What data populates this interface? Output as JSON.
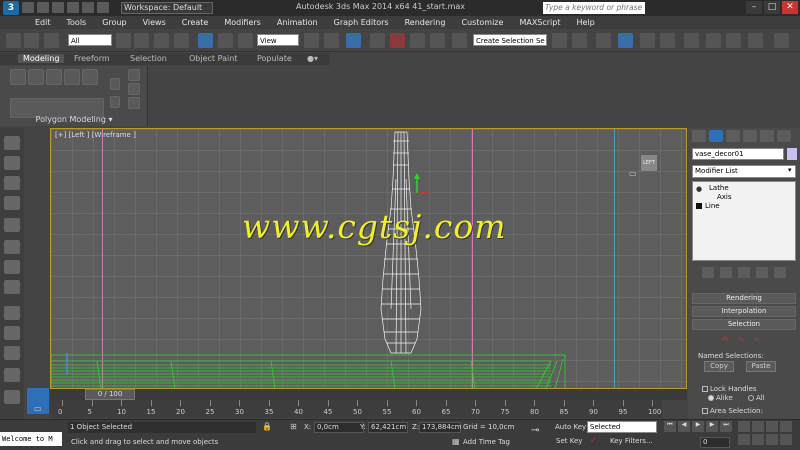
{
  "titlebar": {
    "workspace": "Workspace: Default",
    "title": "Autodesk 3ds Max  2014 x64     41_start.max",
    "search_placeholder": "Type a keyword or phrase"
  },
  "menu": [
    "Edit",
    "Tools",
    "Group",
    "Views",
    "Create",
    "Modifiers",
    "Animation",
    "Graph Editors",
    "Rendering",
    "Customize",
    "MAXScript",
    "Help"
  ],
  "toolbar": {
    "filter": "All",
    "refcoord": "View",
    "selection_set": "Create Selection Se"
  },
  "ribbon": {
    "tabs": [
      "Modeling",
      "Freeform",
      "Selection",
      "Object Paint",
      "Populate"
    ],
    "panel_label": "Polygon Modeling"
  },
  "viewport": {
    "label": "[+] [Left ] [Wireframe ]",
    "viewcube": "LEFT",
    "watermark": "www.cgtsj.com"
  },
  "timeline": {
    "frame": "0 / 100",
    "ticks": [
      "0",
      "5",
      "10",
      "15",
      "20",
      "25",
      "30",
      "35",
      "40",
      "45",
      "50",
      "55",
      "60",
      "65",
      "70",
      "75",
      "80",
      "85",
      "90",
      "95",
      "100"
    ]
  },
  "status": {
    "maxscript": "Welcome to M",
    "objects_selected": "1 Object Selected",
    "prompt": "Click and drag to select and move objects",
    "x_label": "X:",
    "x": "0,0cm",
    "y_label": "Y:",
    "y": "62,421cm",
    "z_label": "Z:",
    "z": "173,884cm",
    "grid": "Grid = 10,0cm",
    "add_time_tag": "Add Time Tag",
    "auto_key": "Auto Key",
    "set_key": "Set Key",
    "key_mode": "Selected",
    "key_filters": "Key Filters...",
    "frame_field": "0"
  },
  "command_panel": {
    "object_name": "vase_decor01",
    "object_color": "#c9c0f0",
    "modifier_list": "Modifier List",
    "stack": [
      "Lathe",
      "Axis",
      "Line"
    ],
    "rollouts": [
      "Rendering",
      "Interpolation",
      "Selection"
    ],
    "named_selections": "Named Selections:",
    "copy": "Copy",
    "paste": "Paste",
    "lock_handles": "Lock Handles",
    "alike": "Alike",
    "all": "All",
    "area_selection": "Area Selection:"
  },
  "colors": {
    "viewport_border": "#b89a28",
    "wireframe_green": "#2fd22f",
    "watermark": "#f2ee2a",
    "active_tab": "#2f6fb8"
  }
}
